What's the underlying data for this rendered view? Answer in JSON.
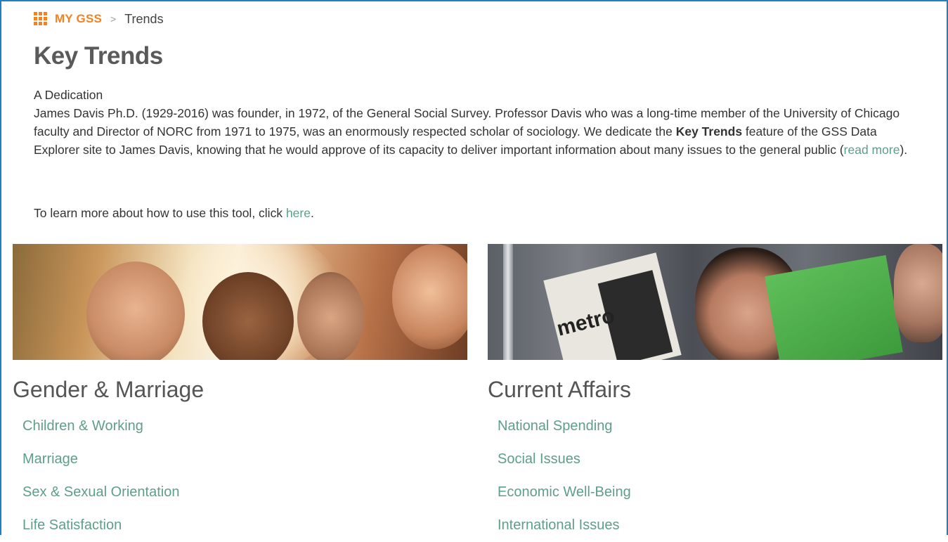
{
  "breadcrumb": {
    "home_label": "MY GSS",
    "separator": ">",
    "current": "Trends"
  },
  "page": {
    "title": "Key Trends"
  },
  "dedication": {
    "heading": "A Dedication",
    "text_1": "James Davis Ph.D. (1929-2016) was founder, in 1972, of the General Social Survey. Professor Davis who was a long-time member of the University of Chicago faculty and Director of NORC from 1971 to 1975, was an enormously respected scholar of sociology. We dedicate the ",
    "bold": "Key Trends",
    "text_2": " feature of the GSS Data Explorer site to James Davis, knowing that he would approve of its capacity to deliver important information about many issues to the general public (",
    "link_label": "read more",
    "text_3": ")."
  },
  "howto": {
    "text": "To learn more about how to use this tool, click ",
    "link_label": "here",
    "suffix": "."
  },
  "sections": {
    "left": {
      "title": "Gender & Marriage",
      "links": [
        "Children & Working",
        "Marriage",
        "Sex & Sexual Orientation",
        "Life Satisfaction"
      ]
    },
    "right": {
      "title": "Current Affairs",
      "links": [
        "National Spending",
        "Social Issues",
        "Economic Well-Being",
        "International Issues"
      ],
      "image_text": "metro"
    }
  },
  "colors": {
    "accent_orange": "#f5821f",
    "link_green": "#5e9e8b",
    "frame_blue": "#1f7fc4"
  }
}
